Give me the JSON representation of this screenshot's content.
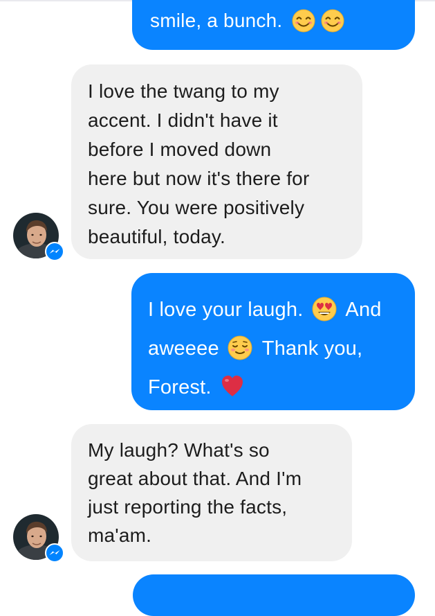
{
  "messages": [
    {
      "direction": "outgoing",
      "lines": [
        {
          "text": "smile, a bunch.",
          "emojis": [
            "smiling-face-emoji",
            "smiling-face-emoji"
          ]
        }
      ]
    },
    {
      "direction": "incoming",
      "lines": [
        {
          "text": "I love the twang to my"
        },
        {
          "text": "accent. I didn't have it"
        },
        {
          "text": "before I moved down"
        },
        {
          "text": "here but now it's there for"
        },
        {
          "text": "sure. You were positively"
        },
        {
          "text": "beautiful, today."
        }
      ]
    },
    {
      "direction": "outgoing",
      "lines": [
        {
          "before": "I love your laugh.",
          "emoji": "heart-eyes-emoji",
          "after": "And"
        },
        {
          "before": "aweeee",
          "emoji": "relieved-smile-emoji",
          "after": "Thank you,"
        },
        {
          "before": "Forest.",
          "emoji": "red-heart-emoji",
          "after": ""
        }
      ]
    },
    {
      "direction": "incoming",
      "lines": [
        {
          "text": "My laugh? What's so"
        },
        {
          "text": "great about that. And I'm"
        },
        {
          "text": "just reporting the facts,"
        },
        {
          "text": "ma'am."
        }
      ]
    }
  ],
  "colors": {
    "outgoing_bubble": "#0a84ff",
    "incoming_bubble": "#f0f0f0",
    "messenger_badge": "#0084ff"
  },
  "icons": {
    "avatar_badge": "messenger-icon"
  }
}
